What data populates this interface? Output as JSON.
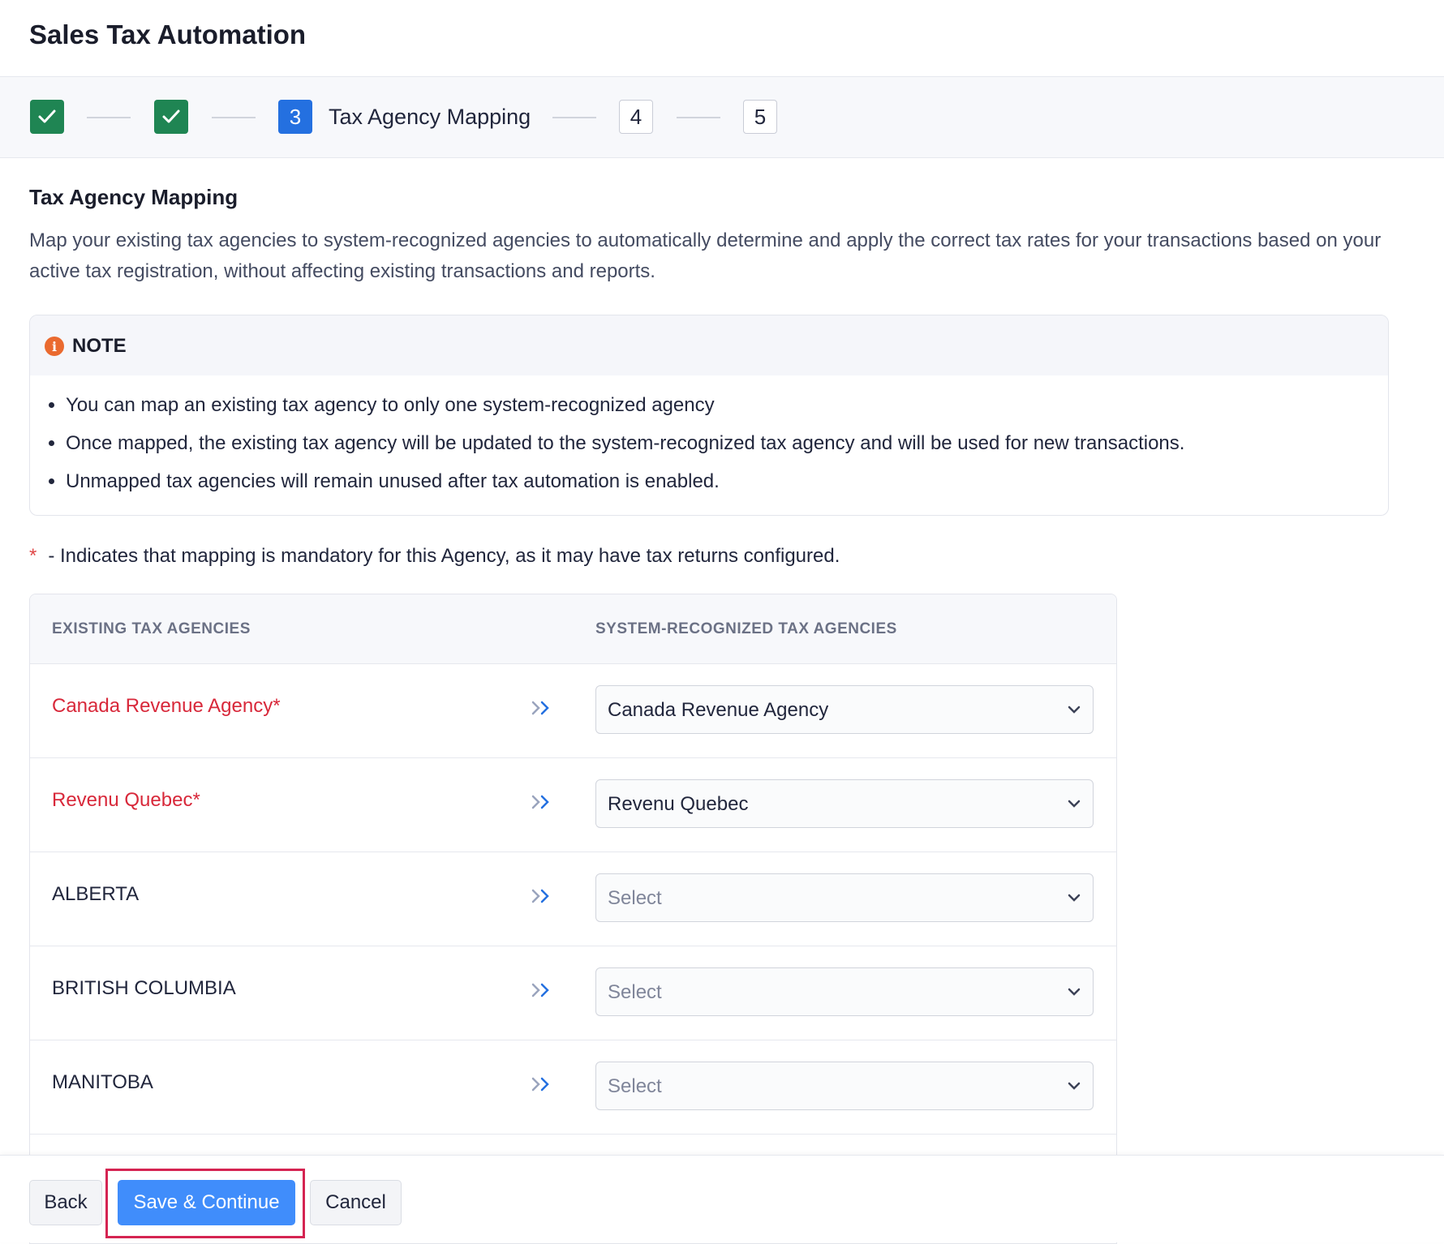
{
  "header": {
    "title": "Sales Tax Automation"
  },
  "stepper": {
    "steps": [
      {
        "state": "done"
      },
      {
        "state": "done"
      },
      {
        "number": "3",
        "label": "Tax Agency Mapping",
        "state": "active"
      },
      {
        "number": "4",
        "state": "future"
      },
      {
        "number": "5",
        "state": "future"
      }
    ]
  },
  "section": {
    "title": "Tax Agency Mapping",
    "description": "Map your existing tax agencies to system-recognized agencies to automatically determine and apply the correct tax rates for your transactions based on your active tax registration, without affecting existing transactions and reports."
  },
  "note": {
    "title": "NOTE",
    "items": [
      "You can map an existing tax agency to only one system-recognized agency",
      "Once mapped, the existing tax agency will be updated to the system-recognized tax agency and will be used for new transactions.",
      "Unmapped tax agencies will remain unused after tax automation is enabled."
    ]
  },
  "mandatory": {
    "star": "*",
    "text": "- Indicates that mapping is mandatory for this Agency, as it may have tax returns configured."
  },
  "table": {
    "headers": {
      "existing": "EXISTING TAX AGENCIES",
      "system": "SYSTEM-RECOGNIZED TAX AGENCIES"
    },
    "rows": [
      {
        "name": "Canada Revenue Agency*",
        "required": true,
        "value": "Canada Revenue Agency"
      },
      {
        "name": "Revenu Quebec*",
        "required": true,
        "value": "Revenu Quebec"
      },
      {
        "name": "ALBERTA",
        "required": false,
        "value": "Select"
      },
      {
        "name": "BRITISH COLUMBIA",
        "required": false,
        "value": "Select"
      },
      {
        "name": "MANITOBA",
        "required": false,
        "value": "Select"
      }
    ]
  },
  "footer": {
    "back": "Back",
    "save": "Save & Continue",
    "cancel": "Cancel"
  },
  "colors": {
    "done": "#1f8553",
    "active": "#2470e0",
    "required": "#d8283a",
    "primary": "#408dfb",
    "highlight": "#d52452"
  }
}
